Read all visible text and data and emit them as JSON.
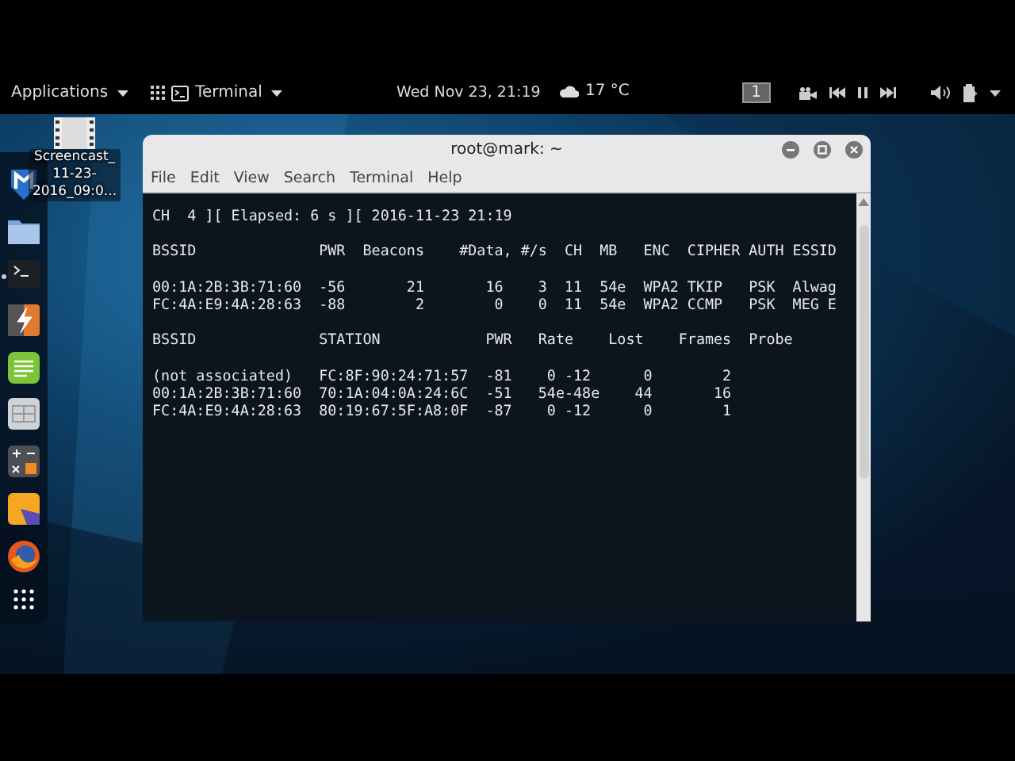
{
  "top_bar": {
    "applications": "Applications",
    "app_menu": "Terminal",
    "clock": "Wed Nov 23, 21:19",
    "weather": "17 °C",
    "workspace": "1"
  },
  "desktop_file": {
    "label": "Screencast_ 11-23- 2016_09:0..."
  },
  "dock": {
    "items": [
      {
        "kind": "shield",
        "active": false
      },
      {
        "kind": "folder",
        "active": false
      },
      {
        "kind": "terminal",
        "active": true
      },
      {
        "kind": "lightning",
        "active": false
      },
      {
        "kind": "notes",
        "active": false
      },
      {
        "kind": "keyboard",
        "active": false
      },
      {
        "kind": "calculator",
        "active": false
      },
      {
        "kind": "shapes",
        "active": false
      },
      {
        "kind": "globe",
        "active": false
      },
      {
        "kind": "grid",
        "active": false
      }
    ]
  },
  "window": {
    "title": "root@mark: ~",
    "menu": [
      "File",
      "Edit",
      "View",
      "Search",
      "Terminal",
      "Help"
    ]
  },
  "terminal": {
    "blocks": [
      [
        "CH  4 ][ Elapsed: 6 s ][ 2016-11-23 21:19"
      ],
      [
        "BSSID              PWR  Beacons    #Data, #/s  CH  MB   ENC  CIPHER AUTH ESSID"
      ],
      [
        "00:1A:2B:3B:71:60  -56       21       16    3  11  54e  WPA2 TKIP   PSK  Alwag",
        "FC:4A:E9:4A:28:63  -88        2        0    0  11  54e  WPA2 CCMP   PSK  MEG E"
      ],
      [
        "BSSID              STATION            PWR   Rate    Lost    Frames  Probe"
      ],
      [
        "(not associated)   FC:8F:90:24:71:57  -81    0 -12      0        2",
        "00:1A:2B:3B:71:60  70:1A:04:0A:24:6C  -51   54e-48e    44       16",
        "FC:4A:E9:4A:28:63  80:19:67:5F:A8:0F  -87    0 -12      0        1"
      ]
    ]
  }
}
